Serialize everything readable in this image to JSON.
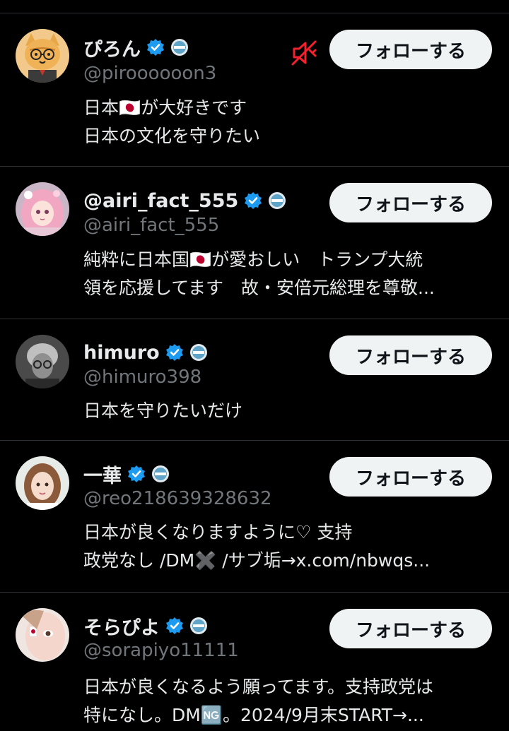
{
  "colors": {
    "background": "#000000",
    "text": "#e7e9ea",
    "handle": "#71767b",
    "divider": "#2f3336",
    "verified_blue": "#1d9bf0",
    "button_bg": "#eff3f4",
    "mute_red": "#f4212e"
  },
  "users": [
    {
      "display_name": "ぴろん",
      "handle": "@piroooooon3",
      "bio_lines": [
        "日本🇯🇵が大好きです",
        "日本の文化を守りたい"
      ],
      "follow_label": "フォローする",
      "verified": true,
      "affiliate_badge": "circle-badge-icon",
      "muted_icon": "mute-speaker-icon"
    },
    {
      "display_name": "@airi_fact_555",
      "handle": "@airi_fact_555",
      "bio_lines": [
        "純粋に日本国🇯🇵が愛おしい　トランプ大統",
        "領を応援してます　故・安倍元総理を尊敬..."
      ],
      "follow_label": "フォローする",
      "verified": true,
      "affiliate_badge": "circle-badge-icon"
    },
    {
      "display_name": "himuro",
      "handle": "@himuro398",
      "bio_lines": [
        "日本を守りたいだけ"
      ],
      "follow_label": "フォローする",
      "verified": true,
      "affiliate_badge": "circle-badge-icon"
    },
    {
      "display_name": "一華",
      "handle": "@reo218639328632",
      "bio_lines": [
        "日本が良くなりますように♡ 支持",
        "政党なし /DM✖️ /サブ垢→x.com/nbwqs..."
      ],
      "follow_label": "フォローする",
      "verified": true,
      "affiliate_badge": "circle-badge-icon"
    },
    {
      "display_name": "そらぴよ",
      "handle": "@sorapiyo11111",
      "bio_lines": [
        "日本が良くなるよう願ってます。支持政党は",
        "特になし。DM🆖。2024/9月末START→..."
      ],
      "follow_label": "フォローする",
      "verified": true,
      "affiliate_badge": "circle-badge-icon"
    }
  ]
}
